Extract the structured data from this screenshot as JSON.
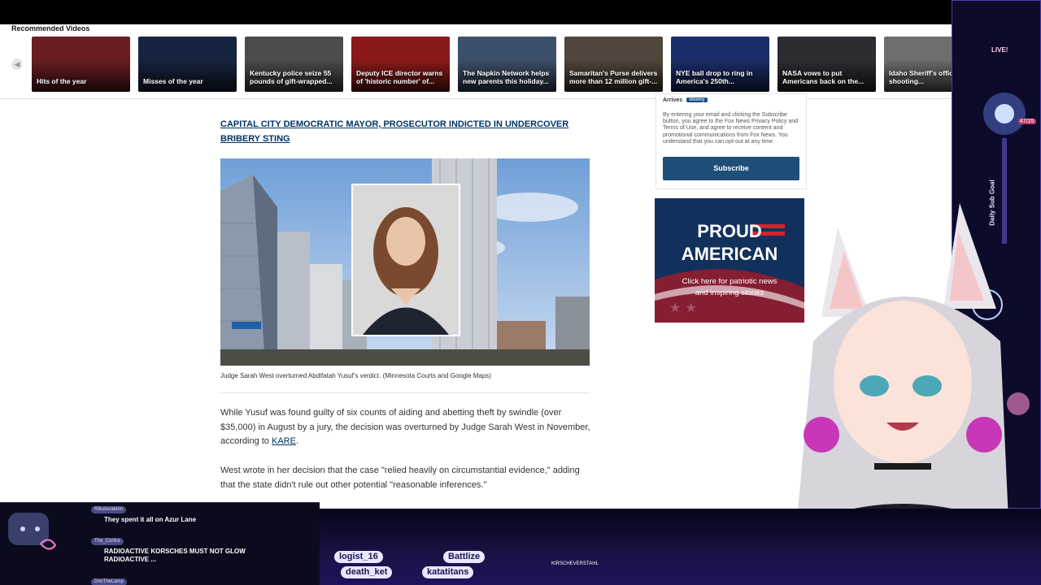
{
  "recommended": {
    "title": "Recommended Videos",
    "items": [
      {
        "caption": "Hits of the year",
        "color": "#6a1d22"
      },
      {
        "caption": "Misses of the year",
        "color": "#16243f"
      },
      {
        "caption": "Kentucky police seize 55 pounds of gift-wrapped...",
        "color": "#4c4c4c"
      },
      {
        "caption": "Deputy ICE director warns of 'historic number' of...",
        "color": "#8a1a18"
      },
      {
        "caption": "The Napkin Network helps new parents this holiday...",
        "color": "#3d5069"
      },
      {
        "caption": "Samaritan's Purse delivers more than 12 million gift-...",
        "color": "#51463b"
      },
      {
        "caption": "NYE ball drop to ring in America's 250th...",
        "color": "#1b2d6a"
      },
      {
        "caption": "NASA vows to put Americans back on the...",
        "color": "#2c2c32"
      },
      {
        "caption": "Idaho Sheriff's office shooting...",
        "color": "#6e6e6e"
      }
    ]
  },
  "article": {
    "related_link": "CAPITAL CITY DEMOCRATIC MAYOR, PROSECUTOR INDICTED IN UNDERCOVER BRIBERY STING",
    "caption": "Judge Sarah West overturned Abdifatah Yusuf's verdict. (Minnesota Courts and Google Maps)",
    "para1_text": "While Yusuf was found guilty of six counts of aiding and abetting theft by swindle (over $35,000) in August by a jury, the decision was overturned by Judge Sarah West in November, according to ",
    "para1_link": "KARE",
    "para1_end": ".",
    "para2": "West wrote in her decision that the case \"relied heavily on circumstantial evidence,\" adding that the state didn't rule out other potential \"reasonable inferences.\""
  },
  "signup": {
    "arrives": "Arrives",
    "badge": "Weekly",
    "disclaimer": "By entering your email and clicking the Subscribe button, you agree to the Fox News Privacy Policy and Terms of Use, and agree to receive content and promotional communications from Fox News. You understand that you can opt-out at any time.",
    "button": "Subscribe"
  },
  "ad": {
    "line1": "PROUD",
    "line2": "AMERICAN",
    "sub1": "Click here for patriotic news",
    "sub2": "and inspiring stories"
  },
  "stream": {
    "chat": [
      {
        "user": "Rikusurateon",
        "text": "They spent it all on Azur Lane"
      },
      {
        "user": "The_Contra",
        "text": "RADIOACTIVE KORSCHES MUST NOT GLOW RADIOACTIVE ..."
      },
      {
        "user": "DimTheLamp",
        "text": ""
      }
    ],
    "names": [
      "logist_16",
      "Battlize",
      "death_ket",
      "katatitans"
    ],
    "handle": "KIRSCHEVERSTAHL",
    "live_label": "LIVE!",
    "sub_goal_label": "Daily Sub Goal",
    "sub_goal_count": "47/25"
  }
}
